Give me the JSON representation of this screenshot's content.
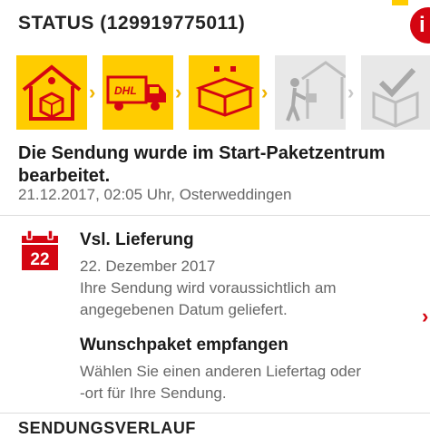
{
  "status": {
    "title": "STATUS (129919775011)",
    "info_icon_label": "i"
  },
  "steps": [
    {
      "name": "Auftrag",
      "icon": "house-package-icon",
      "state": "done"
    },
    {
      "name": "Transport",
      "icon": "dhl-truck-icon",
      "state": "done"
    },
    {
      "name": "Paketzentrum",
      "icon": "packages-icon",
      "state": "current"
    },
    {
      "name": "Zustellung",
      "icon": "courier-delivery-icon",
      "state": "pending"
    },
    {
      "name": "Zugestellt",
      "icon": "delivered-box-check-icon",
      "state": "pending"
    }
  ],
  "event": {
    "message": "Die Sendung wurde im Start-Paketzentrum bearbeitet.",
    "meta": "21.12.2017, 02:05 Uhr, Osterweddingen"
  },
  "delivery": {
    "calendar_day": "22",
    "title": "Vsl. Lieferung",
    "date": "22. Dezember 2017",
    "description_line1": "Ihre Sendung wird voraussichtlich am",
    "description_line2": "angegebenen Datum geliefert."
  },
  "wunschpaket": {
    "title": "Wunschpaket empfangen",
    "description_line1": "Wählen Sie einen anderen Liefertag oder",
    "description_line2": "-ort für Ihre Sendung."
  },
  "history": {
    "heading": "SENDUNGSVERLAUF"
  },
  "colors": {
    "dhl_yellow": "#ffcc00",
    "dhl_red": "#d40511",
    "inactive_gray": "#e6e6e6"
  }
}
